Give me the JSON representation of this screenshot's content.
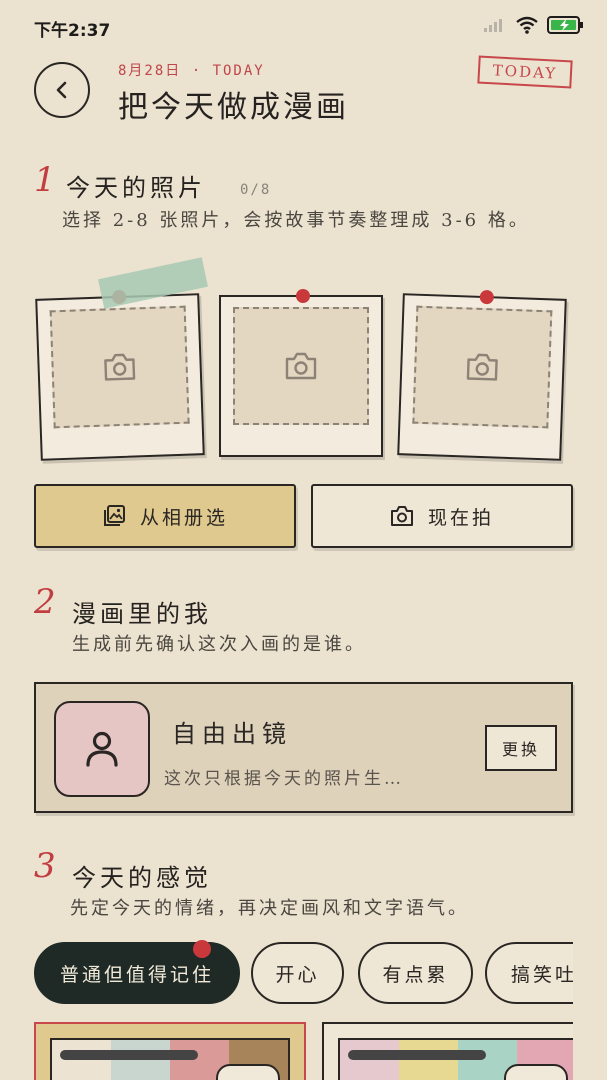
{
  "status": {
    "time": "下午2:37"
  },
  "header": {
    "date": "8月28日 · TODAY",
    "title": "把今天做成漫画",
    "stamp": "TODAY"
  },
  "section1": {
    "num": "1",
    "title": "今天的照片",
    "counter": "0/8",
    "desc": "选择 2-8 张照片，会按故事节奏整理成 3-6 格。"
  },
  "actions": {
    "album": "从相册选",
    "camera": "现在拍"
  },
  "section2": {
    "num": "2",
    "title": "漫画里的我",
    "desc": "生成前先确认这次入画的是谁。"
  },
  "character": {
    "name": "自由出镜",
    "desc": "这次只根据今天的照片生…",
    "change": "更换"
  },
  "section3": {
    "num": "3",
    "title": "今天的感觉",
    "desc": "先定今天的情绪，再决定画风和文字语气。"
  },
  "moods": [
    "普通但值得记住",
    "开心",
    "有点累",
    "搞笑吐"
  ],
  "colors": {
    "background": "#ebe2d0",
    "accent_red": "#c9393c",
    "album_button": "#dfc98e",
    "active_chip": "#1f2a26",
    "avatar_bg": "#e6c6c4",
    "tape": "#a7c9b3"
  },
  "icons": {
    "back": "chevron-left-icon",
    "photo_slot": "camera-icon",
    "album": "gallery-icon",
    "camera": "camera-icon",
    "avatar": "person-icon"
  }
}
